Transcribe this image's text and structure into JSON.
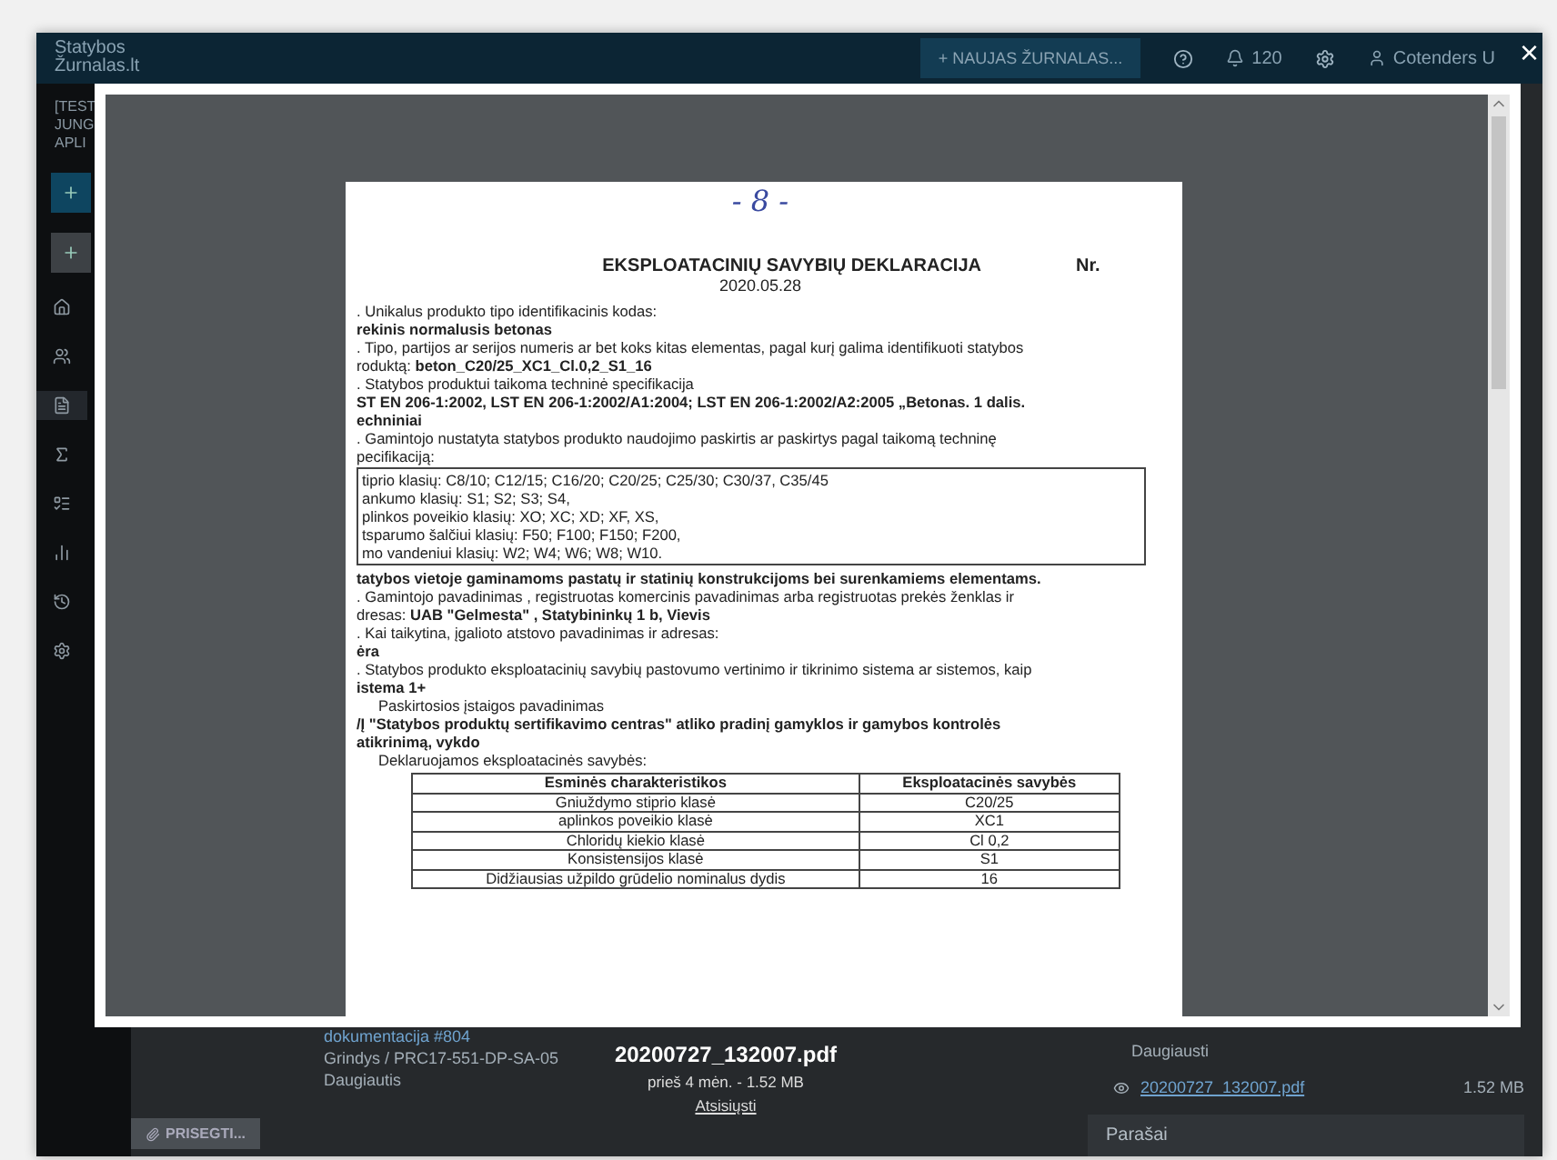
{
  "header": {
    "logo_lines": [
      "Statybos",
      "Žurnalas.lt"
    ],
    "new_journal_button": "+ NAUJAS ŽURNALAS...",
    "notifications_count": "120",
    "user_name": "Cotenders U"
  },
  "sidebar": {
    "project_lines": [
      "[TEST",
      "JUNG",
      "APLI"
    ],
    "icons": [
      {
        "kind": "home",
        "selected": false
      },
      {
        "kind": "users",
        "selected": false
      },
      {
        "kind": "file",
        "selected": true
      },
      {
        "kind": "sigma",
        "selected": false
      },
      {
        "kind": "list",
        "selected": false
      },
      {
        "kind": "chart",
        "selected": false
      },
      {
        "kind": "history",
        "selected": false
      },
      {
        "kind": "settings",
        "selected": false
      }
    ]
  },
  "background": {
    "entry_link": "dokumentacija #804",
    "entry_path": "Grindys / PRC17-551-DP-SA-05",
    "entry_status": "Daugiautis",
    "attach_button": "PRISEGTI...",
    "right_status": "Daugiausti",
    "file_link": "20200727_132007.pdf",
    "file_size": "1.52 MB",
    "signatures_title": "Parašai"
  },
  "viewer": {
    "close": "×",
    "document": {
      "handwritten": "- 8 -",
      "title": "EKSPLOATACINIŲ SAVYBIŲ DEKLARACIJA",
      "number_label": "Nr.",
      "date": "2020.05.28",
      "blocks": [
        {
          "kind": "text",
          "text": ". Unikalus produkto tipo identifikacinis kodas:"
        },
        {
          "kind": "bold",
          "text": "rekinis normalusis betonas"
        },
        {
          "kind": "text",
          "text": ". Tipo, partijos ar serijos numeris ar bet koks kitas elementas, pagal kurį galima identifikuoti statybos"
        },
        {
          "kind": "text",
          "text": "roduktą: **beton_C20/25_XC1_Cl.0,2_S1_16**"
        },
        {
          "kind": "text",
          "text": ". Statybos produktui taikoma techninė specifikacija"
        },
        {
          "kind": "bold",
          "text": "ST EN 206-1:2002, LST EN 206-1:2002/A1:2004; LST EN 206-1:2002/A2:2005 „Betonas. 1 dalis."
        },
        {
          "kind": "bold",
          "text": "echniniai"
        },
        {
          "kind": "text",
          "text": ". Gamintojo nustatyta statybos produkto naudojimo paskirtis ar paskirtys pagal taikomą techninę"
        },
        {
          "kind": "text",
          "text": "pecifikaciją:"
        },
        {
          "kind": "box",
          "lines": [
            "tiprio klasių: C8/10; C12/15; C16/20; C20/25; C25/30; C30/37, C35/45",
            "ankumo klasių: S1; S2; S3; S4,",
            "plinkos poveikio klasių: XO; XC; XD; XF, XS,",
            "tsparumo šalčiui klasių: F50; F100; F150; F200,",
            "mo vandeniui klasių: W2; W4; W6; W8; W10."
          ]
        },
        {
          "kind": "bold",
          "text": "tatybos vietoje gaminamoms pastatų ir statinių konstrukcijoms bei surenkamiems elementams."
        },
        {
          "kind": "text",
          "text": ". Gamintojo pavadinimas , registruotas komercinis pavadinimas arba registruotas prekės ženklas ir"
        },
        {
          "kind": "text",
          "text": "dresas: **UAB \"Gelmesta\" , Statybininkų 1 b, Vievis**"
        },
        {
          "kind": "text",
          "text": ". Kai taikytina, įgalioto atstovo pavadinimas ir adresas:"
        },
        {
          "kind": "bold",
          "text": "ėra"
        },
        {
          "kind": "text",
          "text": ". Statybos produkto eksploatacinių savybių pastovumo vertinimo ir tikrinimo sistema ar sistemos, kaip"
        },
        {
          "kind": "bold",
          "text": "istema 1+"
        },
        {
          "kind": "indent",
          "text": "Paskirtosios įstaigos pavadinimas"
        },
        {
          "kind": "bold",
          "text": "/Į \"Statybos produktų sertifikavimo centras\" atliko pradinį gamyklos ir gamybos kontrolės"
        },
        {
          "kind": "bold",
          "text": "atikrinimą, vykdo"
        },
        {
          "kind": "indent",
          "text": "Deklaruojamos eksploatacinės savybės:"
        },
        {
          "kind": "table",
          "columns": [
            "Esminės charakteristikos",
            "Eksploatacinės savybės"
          ],
          "rows": [
            [
              "Gniuždymo stiprio klasė",
              "C20/25"
            ],
            [
              "aplinkos poveikio klasė",
              "XC1"
            ],
            [
              "Chloridų kiekio klasė",
              "Cl 0,2"
            ],
            [
              "Konsistensijos klasė",
              "S1"
            ],
            [
              "Didžiausias užpildo grūdelio nominalus dydis",
              "16"
            ]
          ]
        }
      ]
    }
  },
  "caption": {
    "file_name": "20200727_132007.pdf",
    "meta": "prieš 4 mėn. - 1.52 MB",
    "download_link": "Atsisiųsti"
  }
}
